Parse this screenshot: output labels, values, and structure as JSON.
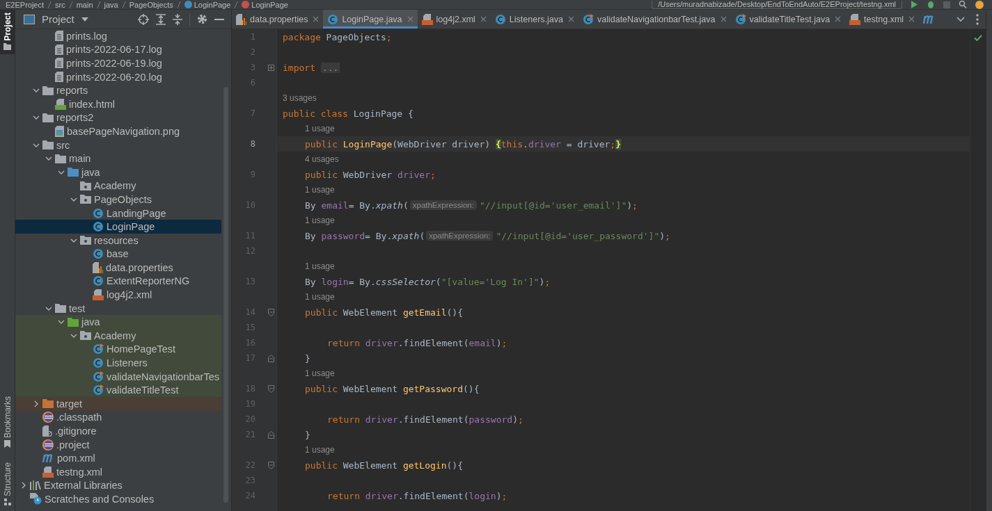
{
  "breadcrumb": [
    {
      "label": "E2EProject",
      "kind": "folder"
    },
    {
      "label": "src",
      "kind": "folder"
    },
    {
      "label": "main",
      "kind": "folder"
    },
    {
      "label": "java",
      "kind": "folder"
    },
    {
      "label": "PageObjects",
      "kind": "folder"
    },
    {
      "label": "LoginPage",
      "kind": "class"
    },
    {
      "label": "LoginPage",
      "kind": "method"
    }
  ],
  "run_config": {
    "value": "/Users/muradnabizade/Desktop/EndToEndAuto/E2EProject/testng.xml"
  },
  "side_tabs": [
    {
      "label": "Project",
      "selected": true,
      "kind": "project"
    },
    {
      "label": "Bookmarks",
      "selected": false,
      "kind": "bookmarks"
    },
    {
      "label": "Structure",
      "selected": false,
      "kind": "structure"
    }
  ],
  "project_panel": {
    "title": "Project"
  },
  "tree": [
    {
      "children": [
        {
          "children": [
            {
              "name": "prints.log",
              "kind": "log",
              "selected": false
            },
            {
              "name": "prints-2022-06-17.log",
              "kind": "log",
              "selected": false
            },
            {
              "name": "prints-2022-06-19.log",
              "kind": "log",
              "selected": false
            },
            {
              "name": "prints-2022-06-20.log",
              "kind": "log",
              "selected": false
            }
          ]
        },
        {
          "name": "reports",
          "kind": "folder",
          "expanded": true,
          "selected": false,
          "children": [
            {
              "name": "index.html",
              "kind": "html",
              "selected": false
            }
          ]
        },
        {
          "name": "reports2",
          "kind": "folder",
          "expanded": true,
          "selected": false,
          "children": [
            {
              "name": "basePageNavigation.png",
              "kind": "image",
              "selected": false
            }
          ]
        },
        {
          "name": "src",
          "kind": "folder",
          "expanded": true,
          "selected": false,
          "children": [
            {
              "name": "main",
              "kind": "folder",
              "expanded": true,
              "selected": false,
              "children": [
                {
                  "name": "java",
                  "kind": "source-folder",
                  "expanded": true,
                  "selected": false,
                  "children": [
                    {
                      "name": "Academy",
                      "kind": "package",
                      "selected": false
                    },
                    {
                      "name": "PageObjects",
                      "kind": "package",
                      "expanded": true,
                      "selected": false,
                      "children": [
                        {
                          "name": "LandingPage",
                          "kind": "class",
                          "selected": false
                        },
                        {
                          "name": "LoginPage",
                          "kind": "class",
                          "selected": true
                        }
                      ]
                    },
                    {
                      "name": "resources",
                      "kind": "package",
                      "expanded": true,
                      "selected": false,
                      "children": [
                        {
                          "name": "base",
                          "kind": "class",
                          "selected": false
                        },
                        {
                          "name": "data.properties",
                          "kind": "properties",
                          "selected": false
                        },
                        {
                          "name": "ExtentReporterNG",
                          "kind": "class",
                          "selected": false
                        },
                        {
                          "name": "log4j2.xml",
                          "kind": "xml",
                          "selected": false
                        }
                      ]
                    }
                  ]
                }
              ]
            },
            {
              "name": "test",
              "kind": "folder",
              "expanded": true,
              "selected": false,
              "children": [
                {
                  "name": "java",
                  "kind": "test-folder",
                  "expanded": true,
                  "selected": false,
                  "test_scope": true,
                  "children": [
                    {
                      "name": "Academy",
                      "kind": "package",
                      "expanded": true,
                      "selected": false,
                      "children": [
                        {
                          "name": "HomePageTest",
                          "kind": "test-class",
                          "selected": false
                        },
                        {
                          "name": "Listeners",
                          "kind": "class",
                          "selected": false
                        },
                        {
                          "name": "validateNavigationbarTes",
                          "kind": "test-class",
                          "selected": false
                        },
                        {
                          "name": "validateTitleTest",
                          "kind": "test-class",
                          "selected": false
                        }
                      ]
                    }
                  ]
                }
              ]
            }
          ]
        },
        {
          "name": "target",
          "kind": "excluded-folder",
          "expanded": false,
          "selected": false,
          "excluded": true
        },
        {
          "name": ".classpath",
          "kind": "eclipse",
          "selected": false
        },
        {
          "name": ".gitignore",
          "kind": "gitignore",
          "selected": false
        },
        {
          "name": ".project",
          "kind": "eclipse",
          "selected": false
        },
        {
          "name": "pom.xml",
          "kind": "maven",
          "selected": false
        },
        {
          "name": "testng.xml",
          "kind": "xml",
          "selected": false
        }
      ]
    },
    {
      "name": "External Libraries",
      "kind": "libraries",
      "expanded": false,
      "selected": false
    },
    {
      "name": "Scratches and Consoles",
      "kind": "scratches",
      "selected": false
    }
  ],
  "tabs": [
    {
      "label": "data.properties",
      "kind": "properties",
      "selected": false
    },
    {
      "label": "LoginPage.java",
      "kind": "class",
      "selected": true
    },
    {
      "label": "log4j2.xml",
      "kind": "xml",
      "selected": false
    },
    {
      "label": "Listeners.java",
      "kind": "class",
      "selected": false
    },
    {
      "label": "validateNavigationbarTest.java",
      "kind": "test-class",
      "selected": false
    },
    {
      "label": "validateTitleTest.java",
      "kind": "test-class",
      "selected": false
    },
    {
      "label": "testng.xml",
      "kind": "xml",
      "selected": false
    },
    {
      "kind": "maven",
      "selected": false
    }
  ],
  "code": [
    {
      "num": "1",
      "kind": "top",
      "parts": [
        {
          "kind": "code",
          "tokens": [
            {
              "text": "package",
              "kind": "kw"
            },
            {
              "text": " PageObjects",
              "kind": "plain"
            },
            {
              "text": ";",
              "kind": "kw"
            }
          ]
        }
      ]
    },
    {
      "num": "2",
      "kind": "top"
    },
    {
      "num": "3",
      "kind": "top",
      "folded": true,
      "parts": [
        {
          "kind": "code",
          "tokens": [
            {
              "text": "import",
              "kind": "kw"
            }
          ]
        },
        {
          "kind": "fold",
          "text": "..."
        }
      ]
    },
    {
      "num": "6",
      "kind": "top"
    },
    {
      "usage": "3 usages",
      "kind": "top"
    },
    {
      "num": "7",
      "kind": "top",
      "parts": [
        {
          "kind": "code",
          "tokens": [
            {
              "text": "public class",
              "kind": "kw"
            },
            {
              "text": " LoginPage {",
              "kind": "plain"
            }
          ]
        }
      ]
    },
    {
      "usage": "1 usage",
      "kind": "member"
    },
    {
      "num": "8",
      "kind": "member",
      "current": true,
      "parts": [
        {
          "kind": "code",
          "tokens": [
            {
              "text": "public ",
              "kind": "kw"
            },
            {
              "text": "LoginPage",
              "kind": "decl"
            },
            {
              "text": "(WebDriver driver) ",
              "kind": "plain"
            },
            {
              "text": "{",
              "kind": "match"
            },
            {
              "text": "this",
              "kind": "kw"
            },
            {
              "text": ".",
              "kind": "plain"
            },
            {
              "text": "driver",
              "kind": "field"
            },
            {
              "text": " = driver",
              "kind": "plain"
            },
            {
              "text": ";",
              "kind": "kw"
            },
            {
              "text": "}",
              "kind": "match"
            }
          ]
        }
      ]
    },
    {
      "usage": "4 usages",
      "kind": "member"
    },
    {
      "num": "9",
      "kind": "member",
      "parts": [
        {
          "kind": "code",
          "tokens": [
            {
              "text": "public",
              "kind": "kw"
            },
            {
              "text": " WebDriver ",
              "kind": "plain"
            },
            {
              "text": "driver",
              "kind": "field"
            },
            {
              "text": ";",
              "kind": "kw"
            }
          ]
        }
      ]
    },
    {
      "usage": "1 usage",
      "kind": "member"
    },
    {
      "num": "10",
      "kind": "member",
      "parts": [
        {
          "kind": "code",
          "tokens": [
            {
              "text": "By ",
              "kind": "plain"
            },
            {
              "text": "email",
              "kind": "field"
            },
            {
              "text": "= By.",
              "kind": "plain"
            },
            {
              "text": "xpath",
              "kind": "call"
            },
            {
              "text": "(",
              "kind": "plain"
            }
          ]
        },
        {
          "kind": "hint",
          "text": "xpathExpression:"
        },
        {
          "kind": "code",
          "tokens": [
            {
              "text": "\"//input[@id='user_email']\"",
              "kind": "str"
            },
            {
              "text": ")",
              "kind": "plain"
            },
            {
              "text": ";",
              "kind": "kw"
            }
          ]
        }
      ]
    },
    {
      "usage": "1 usage",
      "kind": "member"
    },
    {
      "num": "11",
      "kind": "member",
      "parts": [
        {
          "kind": "code",
          "tokens": [
            {
              "text": "By ",
              "kind": "plain"
            },
            {
              "text": "password",
              "kind": "field"
            },
            {
              "text": "= By.",
              "kind": "plain"
            },
            {
              "text": "xpath",
              "kind": "call"
            },
            {
              "text": "(",
              "kind": "plain"
            }
          ]
        },
        {
          "kind": "hint",
          "text": "xpathExpression:"
        },
        {
          "kind": "code",
          "tokens": [
            {
              "text": "\"//input[@id='user_password']\"",
              "kind": "str"
            },
            {
              "text": ")",
              "kind": "plain"
            },
            {
              "text": ";",
              "kind": "kw"
            }
          ]
        }
      ]
    },
    {
      "num": "12",
      "kind": "member"
    },
    {
      "usage": "1 usage",
      "kind": "member"
    },
    {
      "num": "13",
      "kind": "member",
      "parts": [
        {
          "kind": "code",
          "tokens": [
            {
              "text": "By ",
              "kind": "plain"
            },
            {
              "text": "login",
              "kind": "field"
            },
            {
              "text": "= By.",
              "kind": "plain"
            },
            {
              "text": "cssSelector",
              "kind": "call"
            },
            {
              "text": "(",
              "kind": "plain"
            },
            {
              "text": "\"[value='Log In']\"",
              "kind": "str"
            },
            {
              "text": ")",
              "kind": "plain"
            },
            {
              "text": ";",
              "kind": "kw"
            }
          ]
        }
      ]
    },
    {
      "usage": "1 usage",
      "kind": "member"
    },
    {
      "num": "14",
      "kind": "member",
      "fold_start": true,
      "parts": [
        {
          "kind": "code",
          "tokens": [
            {
              "text": "public",
              "kind": "kw"
            },
            {
              "text": " WebElement ",
              "kind": "plain"
            },
            {
              "text": "getEmail",
              "kind": "decl"
            },
            {
              "text": "(){",
              "kind": "plain"
            }
          ]
        }
      ]
    },
    {
      "num": "15",
      "kind": "member"
    },
    {
      "num": "16",
      "kind": "body",
      "parts": [
        {
          "kind": "code",
          "tokens": [
            {
              "text": "return ",
              "kind": "kw"
            },
            {
              "text": "driver",
              "kind": "field"
            },
            {
              "text": ".findElement(",
              "kind": "plain"
            },
            {
              "text": "email",
              "kind": "field"
            },
            {
              "text": ")",
              "kind": "plain"
            },
            {
              "text": ";",
              "kind": "kw"
            }
          ]
        }
      ]
    },
    {
      "num": "17",
      "kind": "member",
      "fold_end": true,
      "parts": [
        {
          "kind": "code",
          "tokens": [
            {
              "text": "}",
              "kind": "plain"
            }
          ]
        }
      ]
    },
    {
      "usage": "1 usage",
      "kind": "member"
    },
    {
      "num": "18",
      "kind": "member",
      "fold_start": true,
      "parts": [
        {
          "kind": "code",
          "tokens": [
            {
              "text": "public",
              "kind": "kw"
            },
            {
              "text": " WebElement ",
              "kind": "plain"
            },
            {
              "text": "getPassword",
              "kind": "decl"
            },
            {
              "text": "(){",
              "kind": "plain"
            }
          ]
        }
      ]
    },
    {
      "num": "19",
      "kind": "member"
    },
    {
      "num": "20",
      "kind": "body",
      "parts": [
        {
          "kind": "code",
          "tokens": [
            {
              "text": "return ",
              "kind": "kw"
            },
            {
              "text": "driver",
              "kind": "field"
            },
            {
              "text": ".findElement(",
              "kind": "plain"
            },
            {
              "text": "password",
              "kind": "field"
            },
            {
              "text": ")",
              "kind": "plain"
            },
            {
              "text": ";",
              "kind": "kw"
            }
          ]
        }
      ]
    },
    {
      "num": "21",
      "kind": "member",
      "fold_end": true,
      "parts": [
        {
          "kind": "code",
          "tokens": [
            {
              "text": "}",
              "kind": "plain"
            }
          ]
        }
      ]
    },
    {
      "usage": "1 usage",
      "kind": "member"
    },
    {
      "num": "22",
      "kind": "member",
      "fold_start": true,
      "parts": [
        {
          "kind": "code",
          "tokens": [
            {
              "text": "public",
              "kind": "kw"
            },
            {
              "text": " WebElement ",
              "kind": "plain"
            },
            {
              "text": "getLogin",
              "kind": "decl"
            },
            {
              "text": "(){",
              "kind": "plain"
            }
          ]
        }
      ]
    },
    {
      "num": "23",
      "kind": "member"
    },
    {
      "num": "24",
      "kind": "body",
      "parts": [
        {
          "kind": "code",
          "tokens": [
            {
              "text": "return ",
              "kind": "kw"
            },
            {
              "text": "driver",
              "kind": "field"
            },
            {
              "text": ".findElement(",
              "kind": "plain"
            },
            {
              "text": "login",
              "kind": "field"
            },
            {
              "text": ")",
              "kind": "plain"
            },
            {
              "text": ";",
              "kind": "kw"
            }
          ]
        }
      ]
    }
  ]
}
